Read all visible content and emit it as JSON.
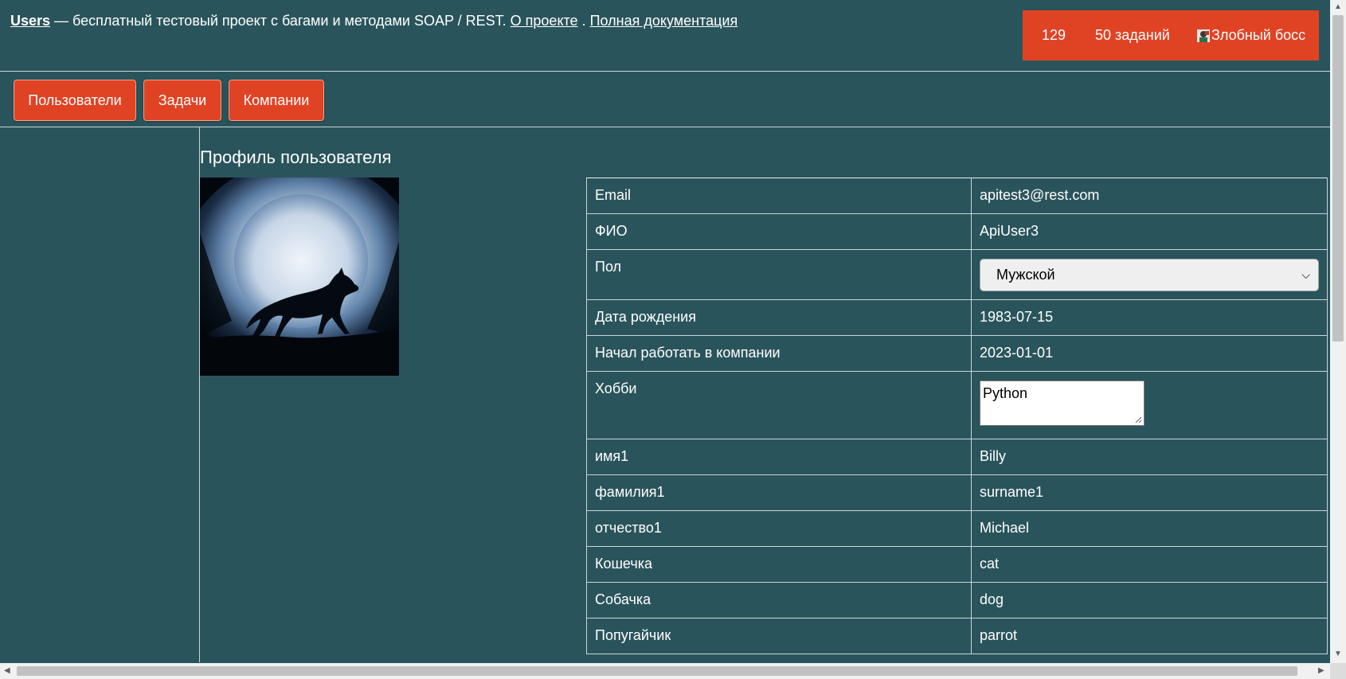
{
  "header": {
    "brand": "Users",
    "tagline": " — бесплатный тестовый проект с багами и методами SOAP / REST. ",
    "about_link": "О проекте",
    "separator": " . ",
    "docs_link": "Полная документация"
  },
  "status": {
    "count": "129",
    "tasks": "50 заданий",
    "boss": "Злобный босс",
    "boss_icon": "boss-avatar-icon",
    "bg_color": "#e04324"
  },
  "nav": {
    "users": "Пользователи",
    "tasks": "Задачи",
    "companies": "Компании"
  },
  "page": {
    "title": "Профиль пользователя",
    "avatar_icon": "wolf-moon-image"
  },
  "profile": {
    "rows": [
      {
        "label": "Email",
        "value": "apitest3@rest.com"
      },
      {
        "label": "ФИО",
        "value": "ApiUser3"
      },
      {
        "label": "Пол",
        "value": "Мужской"
      },
      {
        "label": "Дата рождения",
        "value": "1983-07-15"
      },
      {
        "label": "Начал работать в компании",
        "value": "2023-01-01"
      },
      {
        "label": "Хобби",
        "value": "Python"
      },
      {
        "label": "имя1",
        "value": "Billy"
      },
      {
        "label": "фамилия1",
        "value": "surname1"
      },
      {
        "label": "отчество1",
        "value": "Michael"
      },
      {
        "label": "Кошечка",
        "value": "cat"
      },
      {
        "label": "Собачка",
        "value": "dog"
      },
      {
        "label": "Попугайчик",
        "value": "parrot"
      }
    ]
  },
  "colors": {
    "background": "#2a545c",
    "accent": "#e04324",
    "border": "#c8d6d8"
  }
}
